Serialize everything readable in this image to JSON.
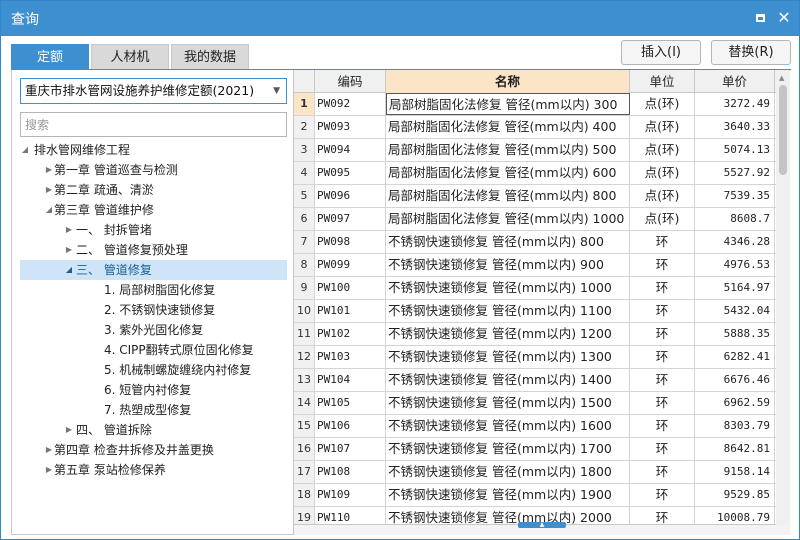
{
  "window": {
    "title": "查询",
    "icons": {
      "maximize": "maximize-icon",
      "close": "close-icon"
    }
  },
  "tabs": [
    {
      "label": "定额",
      "active": true
    },
    {
      "label": "人材机",
      "active": false
    },
    {
      "label": "我的数据",
      "active": false
    }
  ],
  "toolbar": {
    "insert_label": "插入(I)",
    "replace_label": "替换(R)"
  },
  "left": {
    "quota_select": "重庆市排水管网设施养护维修定额(2021)",
    "search_placeholder": "搜索",
    "tree": [
      {
        "label": "排水管网维修工程",
        "expanded": true
      },
      {
        "label": "第一章 管道巡查与检测",
        "expanded": false
      },
      {
        "label": "第二章 疏通、清淤",
        "expanded": false
      },
      {
        "label": "第三章 管道维护修",
        "expanded": true
      },
      {
        "label": "一、 封拆管堵",
        "expanded": false
      },
      {
        "label": "二、 管道修复预处理",
        "expanded": false
      },
      {
        "label": "三、 管道修复",
        "expanded": true,
        "selected": true
      },
      {
        "label": "1. 局部树脂固化修复"
      },
      {
        "label": "2. 不锈钢快速锁修复"
      },
      {
        "label": "3. 紫外光固化修复"
      },
      {
        "label": "4. CIPP翻转式原位固化修复"
      },
      {
        "label": "5. 机械制螺旋缠绕内衬修复"
      },
      {
        "label": "6. 短管内衬修复"
      },
      {
        "label": "7. 热塑成型修复"
      },
      {
        "label": "四、 管道拆除",
        "expanded": false
      },
      {
        "label": "第四章 检查井拆修及井盖更换",
        "expanded": false
      },
      {
        "label": "第五章 泵站检修保养",
        "expanded": false
      }
    ]
  },
  "table": {
    "headers": {
      "code": "编码",
      "name": "名称",
      "unit": "单位",
      "price": "单价"
    },
    "rows": [
      {
        "n": "1",
        "code": "PW092",
        "name": "局部树脂固化法修复 管径(mm以内) 300",
        "unit": "点(环)",
        "price": "3272.49"
      },
      {
        "n": "2",
        "code": "PW093",
        "name": "局部树脂固化法修复 管径(mm以内) 400",
        "unit": "点(环)",
        "price": "3640.33"
      },
      {
        "n": "3",
        "code": "PW094",
        "name": "局部树脂固化法修复 管径(mm以内) 500",
        "unit": "点(环)",
        "price": "5074.13"
      },
      {
        "n": "4",
        "code": "PW095",
        "name": "局部树脂固化法修复 管径(mm以内) 600",
        "unit": "点(环)",
        "price": "5527.92"
      },
      {
        "n": "5",
        "code": "PW096",
        "name": "局部树脂固化法修复 管径(mm以内) 800",
        "unit": "点(环)",
        "price": "7539.35"
      },
      {
        "n": "6",
        "code": "PW097",
        "name": "局部树脂固化法修复 管径(mm以内) 1000",
        "unit": "点(环)",
        "price": "8608.7"
      },
      {
        "n": "7",
        "code": "PW098",
        "name": "不锈钢快速锁修复 管径(mm以内) 800",
        "unit": "环",
        "price": "4346.28"
      },
      {
        "n": "8",
        "code": "PW099",
        "name": "不锈钢快速锁修复 管径(mm以内) 900",
        "unit": "环",
        "price": "4976.53"
      },
      {
        "n": "9",
        "code": "PW100",
        "name": "不锈钢快速锁修复 管径(mm以内) 1000",
        "unit": "环",
        "price": "5164.97"
      },
      {
        "n": "10",
        "code": "PW101",
        "name": "不锈钢快速锁修复 管径(mm以内) 1100",
        "unit": "环",
        "price": "5432.04"
      },
      {
        "n": "11",
        "code": "PW102",
        "name": "不锈钢快速锁修复 管径(mm以内) 1200",
        "unit": "环",
        "price": "5888.35"
      },
      {
        "n": "12",
        "code": "PW103",
        "name": "不锈钢快速锁修复 管径(mm以内) 1300",
        "unit": "环",
        "price": "6282.41"
      },
      {
        "n": "13",
        "code": "PW104",
        "name": "不锈钢快速锁修复 管径(mm以内) 1400",
        "unit": "环",
        "price": "6676.46"
      },
      {
        "n": "14",
        "code": "PW105",
        "name": "不锈钢快速锁修复 管径(mm以内) 1500",
        "unit": "环",
        "price": "6962.59"
      },
      {
        "n": "15",
        "code": "PW106",
        "name": "不锈钢快速锁修复 管径(mm以内) 1600",
        "unit": "环",
        "price": "8303.79"
      },
      {
        "n": "16",
        "code": "PW107",
        "name": "不锈钢快速锁修复 管径(mm以内) 1700",
        "unit": "环",
        "price": "8642.81"
      },
      {
        "n": "17",
        "code": "PW108",
        "name": "不锈钢快速锁修复 管径(mm以内) 1800",
        "unit": "环",
        "price": "9158.14"
      },
      {
        "n": "18",
        "code": "PW109",
        "name": "不锈钢快速锁修复 管径(mm以内) 1900",
        "unit": "环",
        "price": "9529.85"
      },
      {
        "n": "19",
        "code": "PW110",
        "name": "不锈钢快速锁修复 管径(mm以内) 2000",
        "unit": "环",
        "price": "10008.79"
      }
    ]
  },
  "colors": {
    "accent": "#3e8fd0",
    "header_highlight": "#fce4c7",
    "selected_node": "#cfe4f7"
  }
}
